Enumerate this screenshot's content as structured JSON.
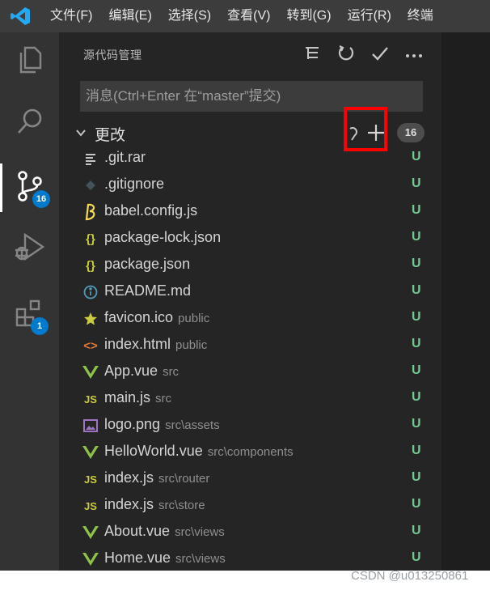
{
  "menubar": {
    "items": [
      "文件(F)",
      "编辑(E)",
      "选择(S)",
      "查看(V)",
      "转到(G)",
      "运行(R)",
      "终端"
    ]
  },
  "activity": {
    "scm_badge": "16",
    "extensions_badge": "1",
    "accent": "#007acc"
  },
  "sidebar": {
    "title": "源代码管理",
    "message_placeholder": "消息(Ctrl+Enter 在“master”提交)",
    "changes_label": "更改",
    "changes_count": "16"
  },
  "files": [
    {
      "name": ".git.rar",
      "dir": "",
      "status": "U",
      "icon": "lines-icon"
    },
    {
      "name": ".gitignore",
      "dir": "",
      "status": "U",
      "icon": "git-diamond-icon"
    },
    {
      "name": "babel.config.js",
      "dir": "",
      "status": "U",
      "icon": "babel-icon"
    },
    {
      "name": "package-lock.json",
      "dir": "",
      "status": "U",
      "icon": "json-icon"
    },
    {
      "name": "package.json",
      "dir": "",
      "status": "U",
      "icon": "json-icon"
    },
    {
      "name": "README.md",
      "dir": "",
      "status": "U",
      "icon": "info-icon"
    },
    {
      "name": "favicon.ico",
      "dir": "public",
      "status": "U",
      "icon": "star-icon"
    },
    {
      "name": "index.html",
      "dir": "public",
      "status": "U",
      "icon": "html-icon"
    },
    {
      "name": "App.vue",
      "dir": "src",
      "status": "U",
      "icon": "vue-icon"
    },
    {
      "name": "main.js",
      "dir": "src",
      "status": "U",
      "icon": "js-icon"
    },
    {
      "name": "logo.png",
      "dir": "src\\assets",
      "status": "U",
      "icon": "image-icon"
    },
    {
      "name": "HelloWorld.vue",
      "dir": "src\\components",
      "status": "U",
      "icon": "vue-icon"
    },
    {
      "name": "index.js",
      "dir": "src\\router",
      "status": "U",
      "icon": "js-icon"
    },
    {
      "name": "index.js",
      "dir": "src\\store",
      "status": "U",
      "icon": "js-icon"
    },
    {
      "name": "About.vue",
      "dir": "src\\views",
      "status": "U",
      "icon": "vue-icon"
    },
    {
      "name": "Home.vue",
      "dir": "src\\views",
      "status": "U",
      "icon": "vue-icon"
    }
  ],
  "watermark": "CSDN @u013250861",
  "colors": {
    "untracked": "#73c991",
    "highlight": "#ff0000"
  }
}
